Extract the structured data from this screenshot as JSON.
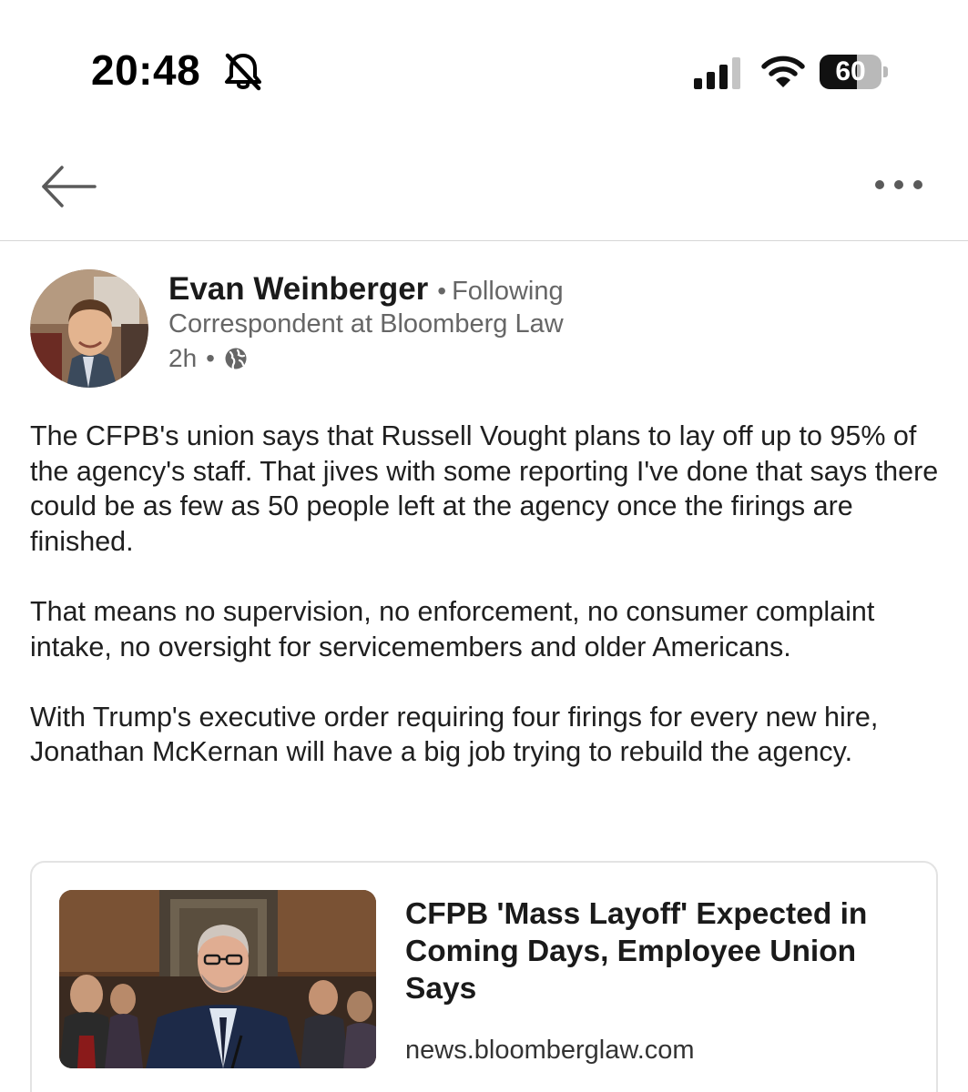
{
  "status_bar": {
    "time": "20:48",
    "battery_level": "60",
    "battery_fraction": 0.6,
    "icons": [
      "bell-off-icon",
      "signal-icon",
      "wifi-icon",
      "battery-icon"
    ]
  },
  "nav": {
    "icons": [
      "back-arrow-icon",
      "more-icon"
    ]
  },
  "post": {
    "author": {
      "name": "Evan Weinberger",
      "follow_status": "Following",
      "headline": "Correspondent at Bloomberg Law"
    },
    "meta": {
      "time_ago": "2h",
      "visibility_icon": "globe-icon"
    },
    "paragraphs": [
      "The CFPB's union says that Russell Vought plans to lay off up to 95% of the agency's staff. That jives with some reporting I've done that says there could be as few as 50 people left at the agency once the firings are finished.",
      "That means no supervision, no enforcement, no consumer complaint intake, no oversight for servicemembers and older Americans.",
      "With Trump's executive order requiring four firings for every new hire, Jonathan McKernan will have a big job trying to rebuild the agency."
    ],
    "article": {
      "title": "CFPB 'Mass Layoff' Expected in Coming Days, Employee Union Says",
      "source": "news.bloomberglaw.com"
    }
  }
}
